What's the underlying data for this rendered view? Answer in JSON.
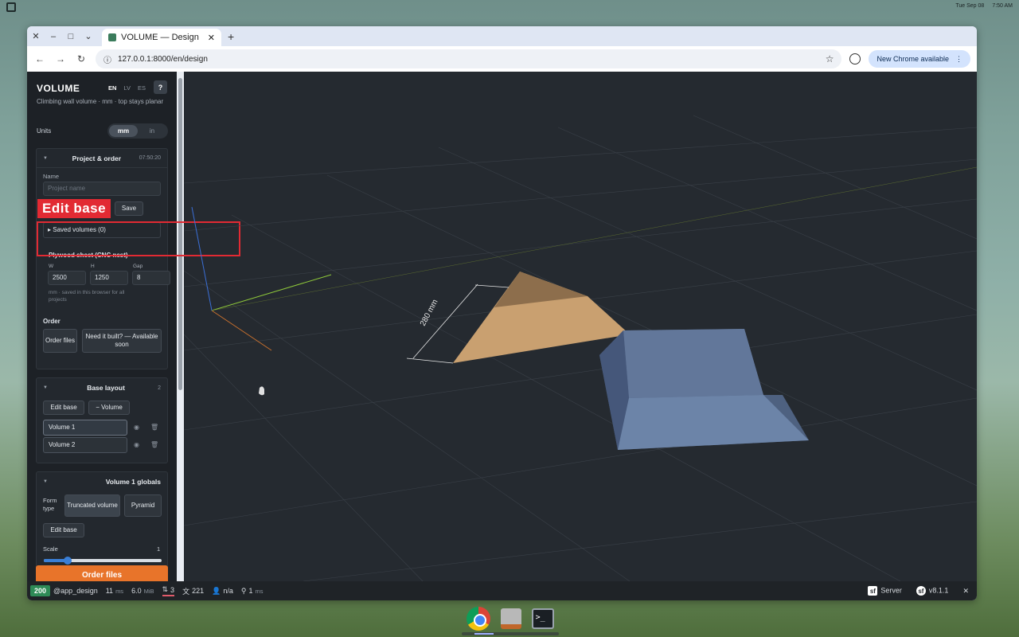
{
  "os": {
    "date": "Tue Sep 08",
    "time": "7:50 AM"
  },
  "browser": {
    "tab_title": "VOLUME — Design",
    "url": "127.0.0.1:8000/en/design",
    "update_label": "New Chrome available"
  },
  "app": {
    "brand": "VOLUME",
    "langs": [
      "EN",
      "LV",
      "ES"
    ],
    "help": "?",
    "subtitle": "Climbing wall volume · mm · top stays planar",
    "units_label": "Units",
    "units": [
      "mm",
      "in"
    ],
    "units_selected": "mm"
  },
  "project": {
    "title": "Project & order",
    "time": "07:50:20",
    "name_label": "Name",
    "name_placeholder": "Project name",
    "save_label": "Save",
    "saved_volumes": "Saved volumes (0)",
    "plywood_title": "Plywood sheet (CNC nest)",
    "w_label": "W",
    "w_value": "2500",
    "h_label": "H",
    "h_value": "1250",
    "gap_label": "Gap",
    "gap_value": "8",
    "plywood_note": "mm · saved in this browser for all projects",
    "order_title": "Order",
    "order_files": "Order files",
    "need_built": "Need it built? — Available soon"
  },
  "base_layout": {
    "title": "Base layout",
    "count": "2",
    "edit_base": "Edit base",
    "add_volume": "− Volume",
    "items": [
      {
        "label": "Volume 1",
        "active": true
      },
      {
        "label": "Volume 2",
        "active": false
      }
    ]
  },
  "globals": {
    "title": "Volume 1 globals",
    "form_type_label": "Form type",
    "form_options": [
      "Truncated volume",
      "Pyramid"
    ],
    "edit_base": "Edit base",
    "scale_label": "Scale",
    "scale_value": "1",
    "scale_fraction": 0.2
  },
  "order_button": "Order files",
  "annotation": {
    "label": "Edit base"
  },
  "scene": {
    "dimension_label": "280 mm"
  },
  "debug": {
    "status": "200",
    "route": "@app_design",
    "time": "11",
    "time_unit": "ms",
    "memory": "6.0",
    "memory_unit": "MiB",
    "requests": "3",
    "translations": "221",
    "user": "n/a",
    "cache": "1",
    "cache_unit": "ms",
    "server": "Server",
    "version": "v8.1.1"
  },
  "colors": {
    "accent_orange": "#e8742a",
    "annotation_red": "#e22a33",
    "status_green": "#2e8b57",
    "pyramid_tan": "#c9a070",
    "volume_blue": "#5d7291"
  }
}
